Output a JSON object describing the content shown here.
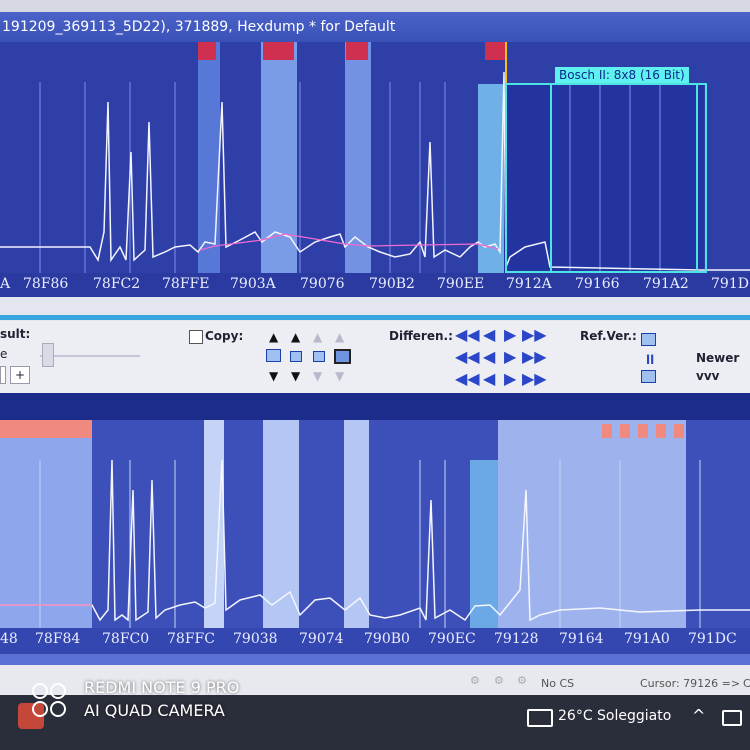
{
  "window": {
    "title": "191209_369113_5D22), 371889, Hexdump * for Default"
  },
  "upper_axis": {
    "labels": [
      "A",
      "78F86",
      "78FC2",
      "78FFE",
      "7903A",
      "79076",
      "790B2",
      "790EE",
      "7912A",
      "79166",
      "791A2",
      "791D"
    ]
  },
  "lower_axis": {
    "labels": [
      "48",
      "78F84",
      "78FC0",
      "78FFC",
      "79038",
      "79074",
      "790B0",
      "790EC",
      "79128",
      "79164",
      "791A0",
      "791DC"
    ]
  },
  "map_tag": {
    "label": "Bosch II: 8x8 (16 Bit)"
  },
  "controls": {
    "result_label": "sult:",
    "result_sub": "e",
    "plus_label": "+",
    "copy_label": "Copy:",
    "differences_label": "Differen.:",
    "refver_label": "Ref.Ver.:",
    "newer_label": "Newer",
    "vvv_label": "vvv"
  },
  "statusbar": {
    "nocs": "No CS",
    "cursor": "Cursor: 79126 =>",
    "end": "C"
  },
  "taskbar": {
    "weather": "26°C Soleggiato"
  },
  "watermark": {
    "line1": "REDMI NOTE 9 PRO",
    "line2": "AI QUAD CAMERA"
  },
  "colors": {
    "accent": "#2b47c7",
    "map_border": "#4fe4e4",
    "marker_red": "#d03050"
  }
}
